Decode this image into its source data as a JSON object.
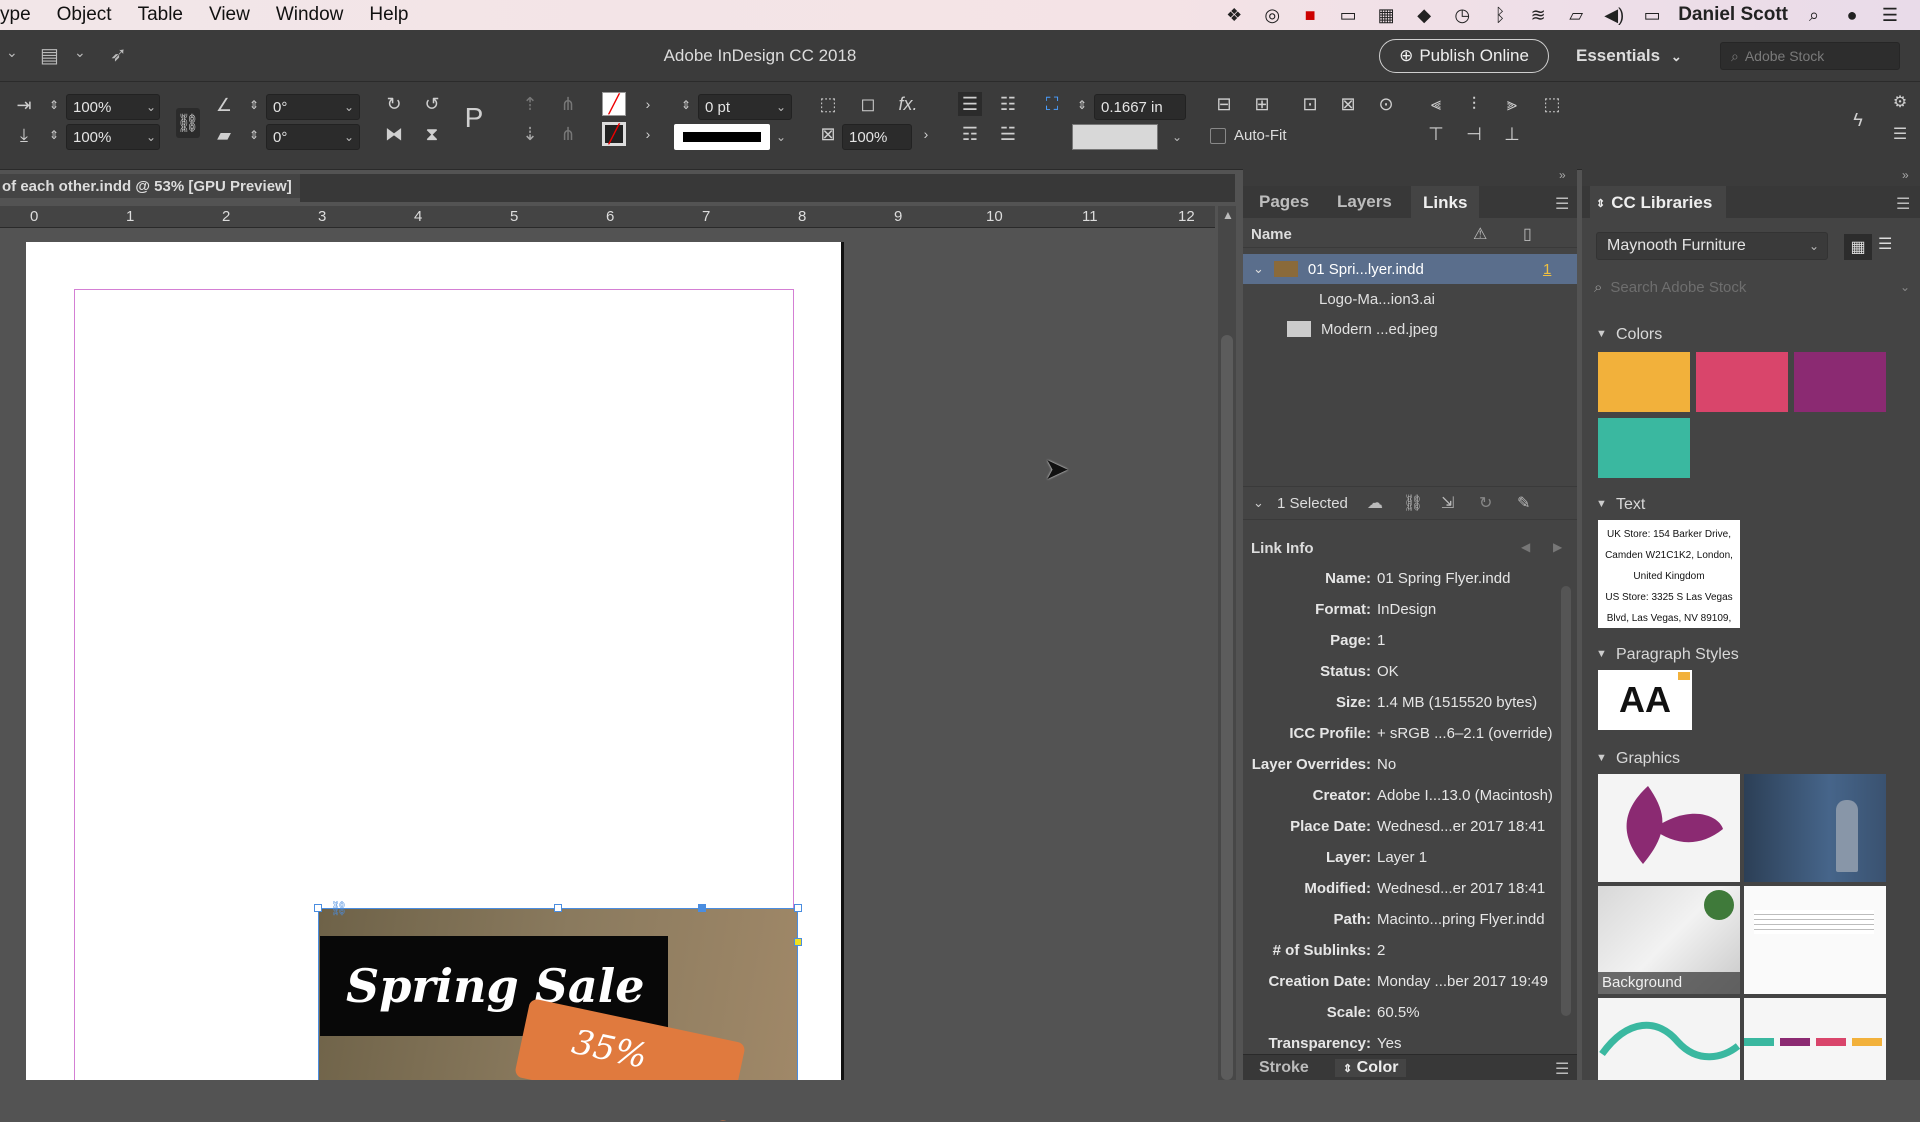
{
  "menubar": {
    "items": [
      "ype",
      "Object",
      "Table",
      "View",
      "Window",
      "Help"
    ],
    "user": "Daniel Scott"
  },
  "appbar": {
    "title": "Adobe InDesign CC 2018",
    "publish_label": "Publish Online",
    "workspace": "Essentials",
    "stock_placeholder": "Adobe Stock"
  },
  "control": {
    "scale_x": "100%",
    "scale_y": "100%",
    "rotate": "0°",
    "shear": "0°",
    "stroke_weight": "0 pt",
    "opacity": "100%",
    "frame_inset": "0.1667 in",
    "autofit_label": "Auto-Fit"
  },
  "document": {
    "tab_title": "of each other.indd @ 53% [GPU Preview]",
    "ruler_ticks": [
      "0",
      "1",
      "2",
      "3",
      "4",
      "5",
      "6",
      "7",
      "8",
      "9",
      "10",
      "11",
      "12"
    ],
    "sale_text": "Spring Sale",
    "tag_text": "35%"
  },
  "links_panel": {
    "tabs": [
      "Pages",
      "Layers",
      "Links"
    ],
    "name_header": "Name",
    "links": [
      {
        "name": "01 Spri...lyer.indd",
        "page": "1"
      },
      {
        "name": "Logo-Ma...ion3.ai",
        "page": ""
      },
      {
        "name": "Modern ...ed.jpeg",
        "page": ""
      }
    ],
    "selected_label": "1 Selected",
    "link_info_title": "Link Info",
    "info": [
      {
        "k": "Name:",
        "v": "01 Spring Flyer.indd"
      },
      {
        "k": "Format:",
        "v": "InDesign"
      },
      {
        "k": "Page:",
        "v": "1"
      },
      {
        "k": "Status:",
        "v": "OK"
      },
      {
        "k": "Size:",
        "v": "1.4 MB (1515520 bytes)"
      },
      {
        "k": "ICC Profile:",
        "v": "+ sRGB ...6–2.1 (override)"
      },
      {
        "k": "Layer Overrides:",
        "v": "No"
      },
      {
        "k": "Creator:",
        "v": "Adobe I...13.0 (Macintosh)"
      },
      {
        "k": "Place Date:",
        "v": "Wednesd...er 2017 18:41"
      },
      {
        "k": "Layer:",
        "v": "Layer 1"
      },
      {
        "k": "Modified:",
        "v": "Wednesd...er 2017 18:41"
      },
      {
        "k": "Path:",
        "v": "Macinto...pring Flyer.indd"
      },
      {
        "k": "# of Sublinks:",
        "v": "2"
      },
      {
        "k": "Creation Date:",
        "v": "Monday ...ber 2017 19:49"
      },
      {
        "k": "Scale:",
        "v": "60.5%"
      },
      {
        "k": "Transparency:",
        "v": "Yes"
      }
    ],
    "bottom_tabs": [
      "Stroke",
      "Color"
    ]
  },
  "cc_libraries": {
    "title": "CC Libraries",
    "library": "Maynooth Furniture",
    "search_placeholder": "Search Adobe Stock",
    "colors_header": "Colors",
    "colors": [
      "#f2b13b",
      "#d9456b",
      "#8b2a72",
      "#3ab8a0"
    ],
    "text_header": "Text",
    "text_sample": [
      "UK Store: 154 Barker Drive,",
      "Camden W21C1K2, London,",
      "United Kingdom",
      "US Store: 3325 S Las Vegas",
      "Blvd, Las Vegas, NV 89109,"
    ],
    "para_header": "Paragraph Styles",
    "para_sample": "AA",
    "graphics_header": "Graphics",
    "graphic_label": "Background"
  }
}
